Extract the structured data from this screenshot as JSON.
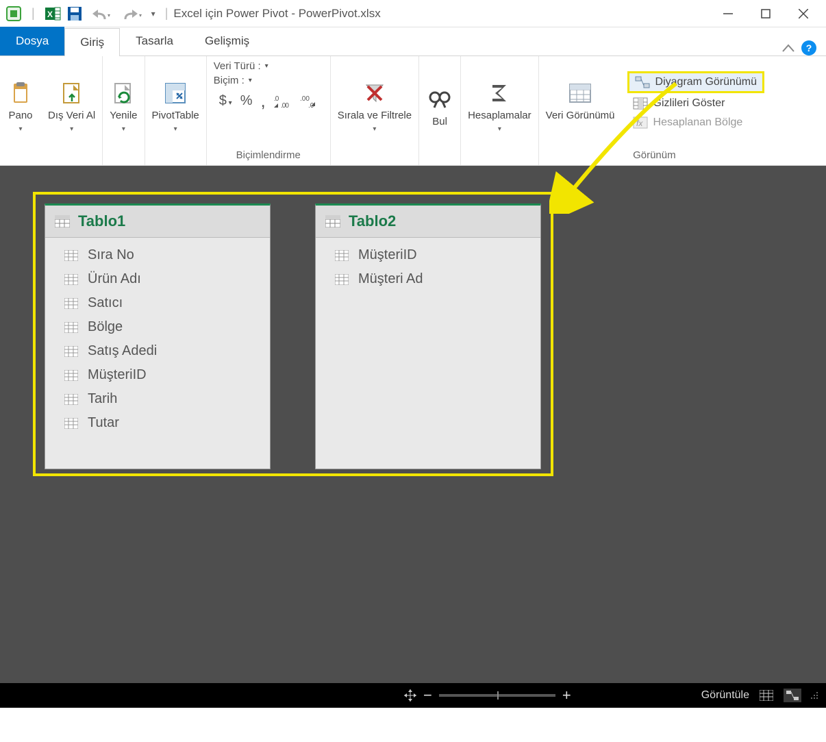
{
  "window": {
    "title": "Excel için Power Pivot - PowerPivot.xlsx"
  },
  "tabs": {
    "file": "Dosya",
    "home": "Giriş",
    "design": "Tasarla",
    "advanced": "Gelişmiş"
  },
  "ribbon": {
    "clipboard": {
      "label": "Pano"
    },
    "getdata": {
      "label": "Dış Veri Al"
    },
    "refresh": {
      "label": "Yenile"
    },
    "pivot": {
      "label": "PivotTable"
    },
    "formatting": {
      "datatype": "Veri Türü :",
      "format": "Biçim :",
      "group_label": "Biçimlendirme"
    },
    "sortfilter": {
      "label": "Sırala ve Filtrele"
    },
    "find": {
      "label": "Bul"
    },
    "calc": {
      "label": "Hesaplamalar"
    },
    "dataview": {
      "label": "Veri Görünümü"
    },
    "view": {
      "diagram": "Diyagram Görünümü",
      "hidden": "Gizlileri Göster",
      "calcarea": "Hesaplanan Bölge",
      "group_label": "Görünüm"
    }
  },
  "tables": {
    "t1": {
      "name": "Tablo1",
      "cols": [
        "Sıra No",
        "Ürün Adı",
        "Satıcı",
        "Bölge",
        "Satış Adedi",
        "MüşteriID",
        "Tarih",
        "Tutar"
      ]
    },
    "t2": {
      "name": "Tablo2",
      "cols": [
        "MüşteriID",
        "Müşteri Ad"
      ]
    }
  },
  "statusbar": {
    "display": "Görüntüle"
  }
}
